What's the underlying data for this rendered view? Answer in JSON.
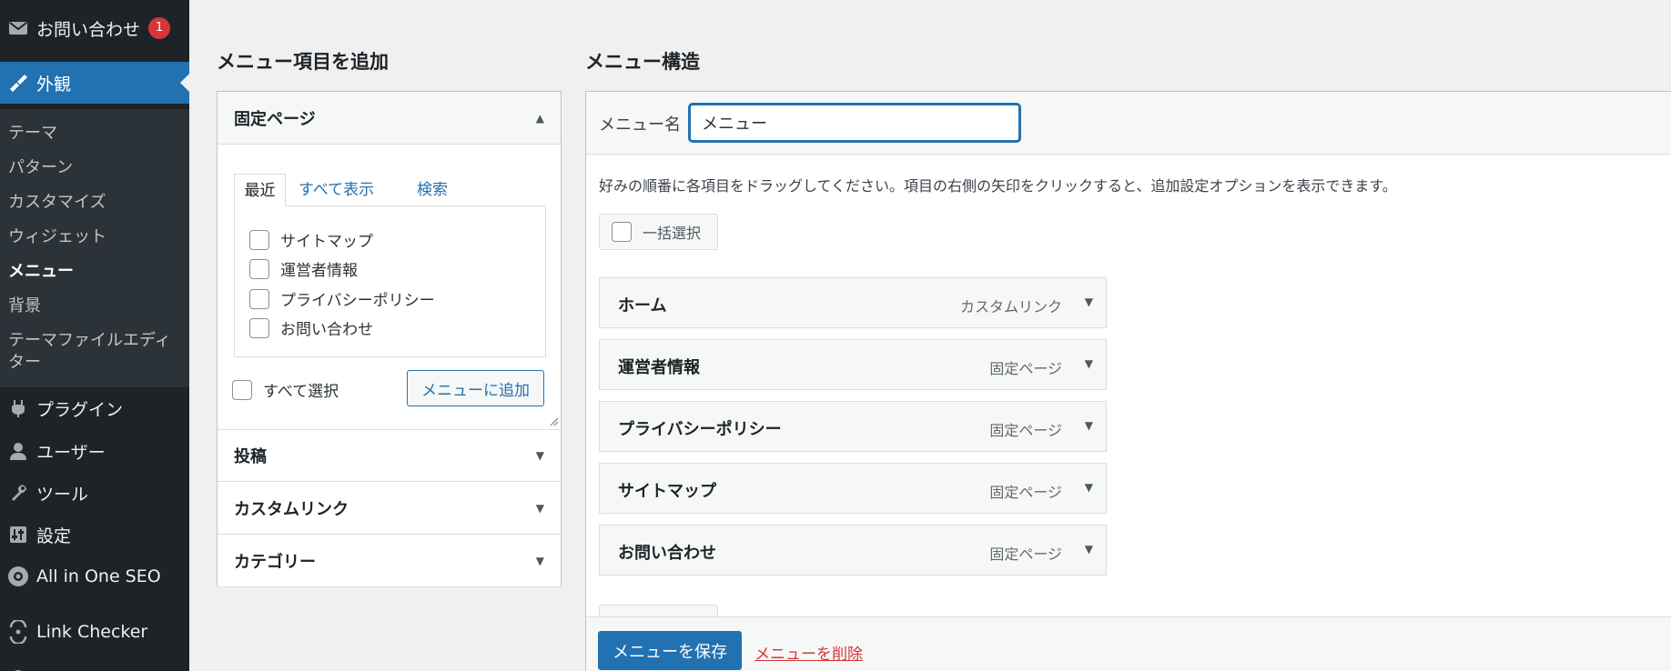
{
  "sidebar": {
    "items": [
      {
        "label": "お問い合わせ",
        "icon": "mail-icon",
        "badge": "1"
      },
      {
        "label": "外観",
        "icon": "appearance-icon"
      },
      {
        "label": "プラグイン",
        "icon": "plugin-icon"
      },
      {
        "label": "ユーザー",
        "icon": "user-icon"
      },
      {
        "label": "ツール",
        "icon": "wrench-icon"
      },
      {
        "label": "設定",
        "icon": "settings-icon"
      },
      {
        "label": "All in One SEO",
        "icon": "seo-gear-icon"
      },
      {
        "label": "Link Checker",
        "icon": "link-checker-icon"
      }
    ],
    "submenu": [
      "テーマ",
      "パターン",
      "カスタマイズ",
      "ウィジェット",
      "メニュー",
      "背景",
      "テーマファイルエディ",
      "ター"
    ]
  },
  "left_panel": {
    "heading": "メニュー項目を追加",
    "sections": [
      "固定ページ",
      "投稿",
      "カスタムリンク",
      "カテゴリー"
    ],
    "tabs": [
      "最近",
      "すべて表示",
      "検索"
    ],
    "pages": [
      "サイトマップ",
      "運営者情報",
      "プライバシーポリシー",
      "お問い合わせ"
    ],
    "select_all": "すべて選択",
    "add_button": "メニューに追加"
  },
  "right_panel": {
    "heading": "メニュー構造",
    "name_label": "メニュー名",
    "name_value": "メニュー",
    "description": "好みの順番に各項目をドラッグしてください。項目の右側の矢印をクリックすると、追加設定オプションを表示できます。",
    "bulk_select": "一括選択",
    "items": [
      {
        "title": "ホーム",
        "type": "カスタムリンク"
      },
      {
        "title": "運営者情報",
        "type": "固定ページ"
      },
      {
        "title": "プライバシーポリシー",
        "type": "固定ページ"
      },
      {
        "title": "サイトマップ",
        "type": "固定ページ"
      },
      {
        "title": "お問い合わせ",
        "type": "固定ページ"
      }
    ],
    "save_button": "メニューを保存",
    "delete_link": "メニューを削除"
  },
  "colors": {
    "sidebar_bg": "#1d2327",
    "accent": "#2271b1",
    "danger": "#d63638"
  }
}
